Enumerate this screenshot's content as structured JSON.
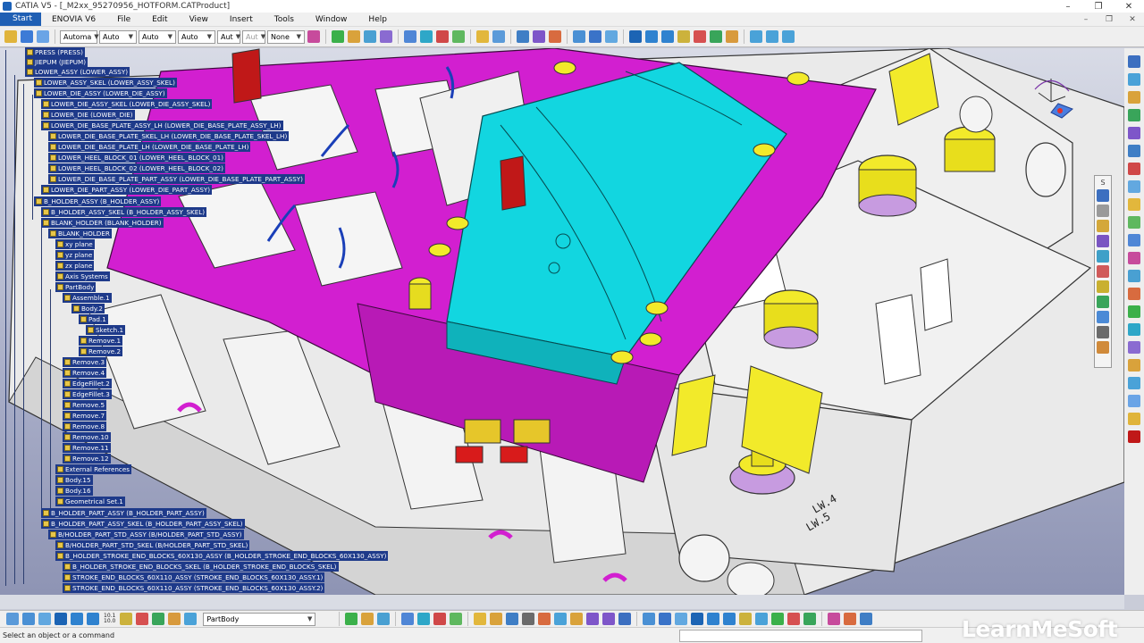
{
  "window": {
    "title": "CATIA V5 - [_M2xx_95270956_HOTFORM.CATProduct]",
    "controls": [
      "–",
      "❐",
      "✕"
    ]
  },
  "menu": {
    "start": "Start",
    "items": [
      "ENOVIA V6",
      "File",
      "Edit",
      "View",
      "Insert",
      "Tools",
      "Window",
      "Help"
    ]
  },
  "toolbar": {
    "combos": [
      "Automa",
      "Auto",
      "Auto",
      "Auto",
      "Aut",
      "Aut",
      "None"
    ],
    "current_body": "PartBody",
    "scale_top": "10.1",
    "scale_bottom": "10.0"
  },
  "tree": {
    "nodes": [
      "PRESS (PRESS)",
      "JIEPUM (JIEPUM)",
      "LOWER_ASSY (LOWER_ASSY)",
      "LOWER_ASSY_SKEL (LOWER_ASSY_SKEL)",
      "LOWER_DIE_ASSY (LOWER_DIE_ASSY)",
      "LOWER_DIE_ASSY_SKEL (LOWER_DIE_ASSY_SKEL)",
      "LOWER_DIE (LOWER_DIE)",
      "LOWER_DIE_BASE_PLATE_ASSY_LH (LOWER_DIE_BASE_PLATE_ASSY_LH)",
      "LOWER_DIE_BASE_PLATE_SKEL_LH (LOWER_DIE_BASE_PLATE_SKEL_LH)",
      "LOWER_DIE_BASE_PLATE_LH (LOWER_DIE_BASE_PLATE_LH)",
      "LOWER_HEEL_BLOCK_01 (LOWER_HEEL_BLOCK_01)",
      "LOWER_HEEL_BLOCK_02 (LOWER_HEEL_BLOCK_02)",
      "LOWER_DIE_BASE_PLATE_PART_ASSY (LOWER_DIE_BASE_PLATE_PART_ASSY)",
      "LOWER_DIE_PART_ASSY (LOWER_DIE_PART_ASSY)",
      "B_HOLDER_ASSY (B_HOLDER_ASSY)",
      "B_HOLDER_ASSY_SKEL (B_HOLDER_ASSY_SKEL)",
      "BLANK_HOLDER (BLANK_HOLDER)",
      "BLANK_HOLDER",
      "xy plane",
      "yz plane",
      "zx plane",
      "Axis Systems",
      "PartBody",
      "Assemble.1",
      "Body.2",
      "Pad.1",
      "Sketch.1",
      "Remove.1",
      "Remove.2",
      "Remove.3",
      "Remove.4",
      "EdgeFillet.2",
      "EdgeFillet.3",
      "Remove.5",
      "Remove.7",
      "Remove.8",
      "Remove.10",
      "Remove.11",
      "Remove.12",
      "External References",
      "Body.15",
      "Body.16",
      "Geometrical Set.1",
      "B_HOLDER_PART_ASSY (B_HOLDER_PART_ASSY)",
      "B_HOLDER_PART_ASSY_SKEL (B_HOLDER_PART_ASSY_SKEL)",
      "B/HOLDER_PART_STD_ASSY (B/HOLDER_PART_STD_ASSY)",
      "B/HOLDER_PART_STD_SKEL (B/HOLDER_PART_STD_SKEL)",
      "B_HOLDER_STROKE_END_BLOCKS_60X130_ASSY (B_HOLDER_STROKE_END_BLOCKS_60X130_ASSY)",
      "B_HOLDER_STROKE_END_BLOCKS_SKEL (B_HOLDER_STROKE_END_BLOCKS_SKEL)",
      "STROKE_END_BLOCKS_60X110_ASSY (STROKE_END_BLOCKS_60X130_ASSY.1)",
      "STROKE_END_BLOCKS_60X110_ASSY (STROKE_END_BLOCKS_60X130_ASSY.2)"
    ]
  },
  "model": {
    "engraving_1": "LW.5",
    "engraving_2": "LW.4"
  },
  "right_toolbar": {
    "header": "S"
  },
  "status": {
    "message": "Select an object or a command"
  },
  "watermark": "LearnMeSoft",
  "colors": {
    "magenta": "#d21fd0",
    "cyan": "#12d6e0",
    "yellow": "#f2ea2a",
    "steel": "#ececec",
    "tree_highlight": "#1e3a8a",
    "background_top": "#d8dbe6",
    "background_bottom": "#8e94b4"
  }
}
